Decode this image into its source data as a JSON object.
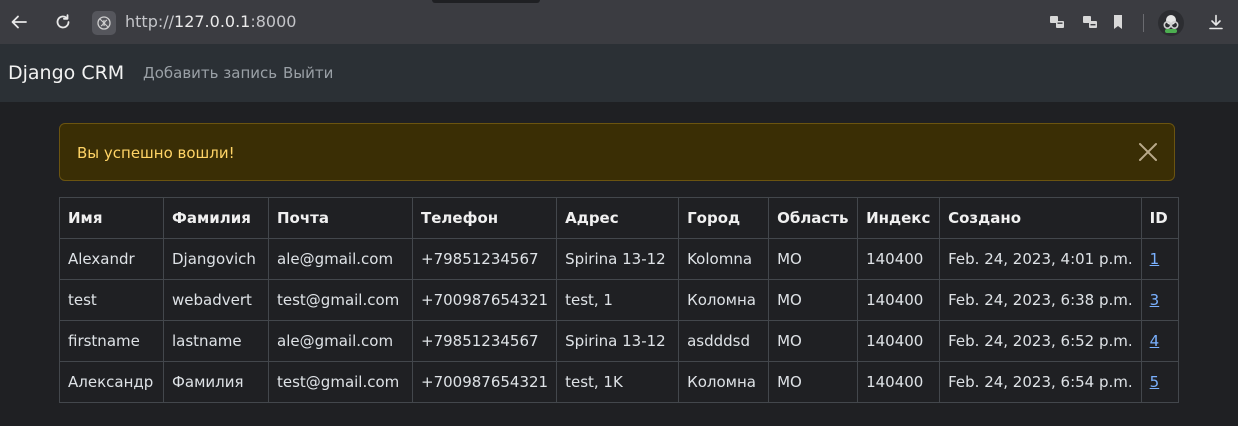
{
  "browser": {
    "url_scheme": "http://",
    "url_host": "127.0.0.1",
    "url_port": ":8000"
  },
  "navbar": {
    "brand": "Django CRM",
    "links": [
      "Добавить запись",
      "Выйти"
    ]
  },
  "alert": {
    "message": "Вы успешно вошли!"
  },
  "table": {
    "headers": [
      "Имя",
      "Фамилия",
      "Почта",
      "Телефон",
      "Адрес",
      "Город",
      "Область",
      "Индекс",
      "Создано",
      "ID"
    ],
    "rows": [
      [
        "Alexandr",
        "Djangovich",
        "ale@gmail.com",
        "+79851234567",
        "Spirina 13-12",
        "Kolomna",
        "MO",
        "140400",
        "Feb. 24, 2023, 4:01 p.m.",
        "1"
      ],
      [
        "test",
        "webadvert",
        "test@gmail.com",
        "+700987654321",
        "test, 1",
        "Коломна",
        "МО",
        "140400",
        "Feb. 24, 2023, 6:38 p.m.",
        "3"
      ],
      [
        "firstname",
        "lastname",
        "ale@gmail.com",
        "+79851234567",
        "Spirina 13-12",
        "asdddsd",
        "MO",
        "140400",
        "Feb. 24, 2023, 6:52 p.m.",
        "4"
      ],
      [
        "Александр",
        "Фамилия",
        "test@gmail.com",
        "+700987654321",
        "test, 1K",
        "Коломна",
        "МО",
        "140400",
        "Feb. 24, 2023, 6:54 p.m.",
        "5"
      ]
    ]
  },
  "colors": {
    "page_bg": "#1f2023",
    "navbar_bg": "#2b3035",
    "alert_bg": "#3a2e05",
    "alert_text": "#ffd466",
    "link": "#7ab1ff"
  }
}
